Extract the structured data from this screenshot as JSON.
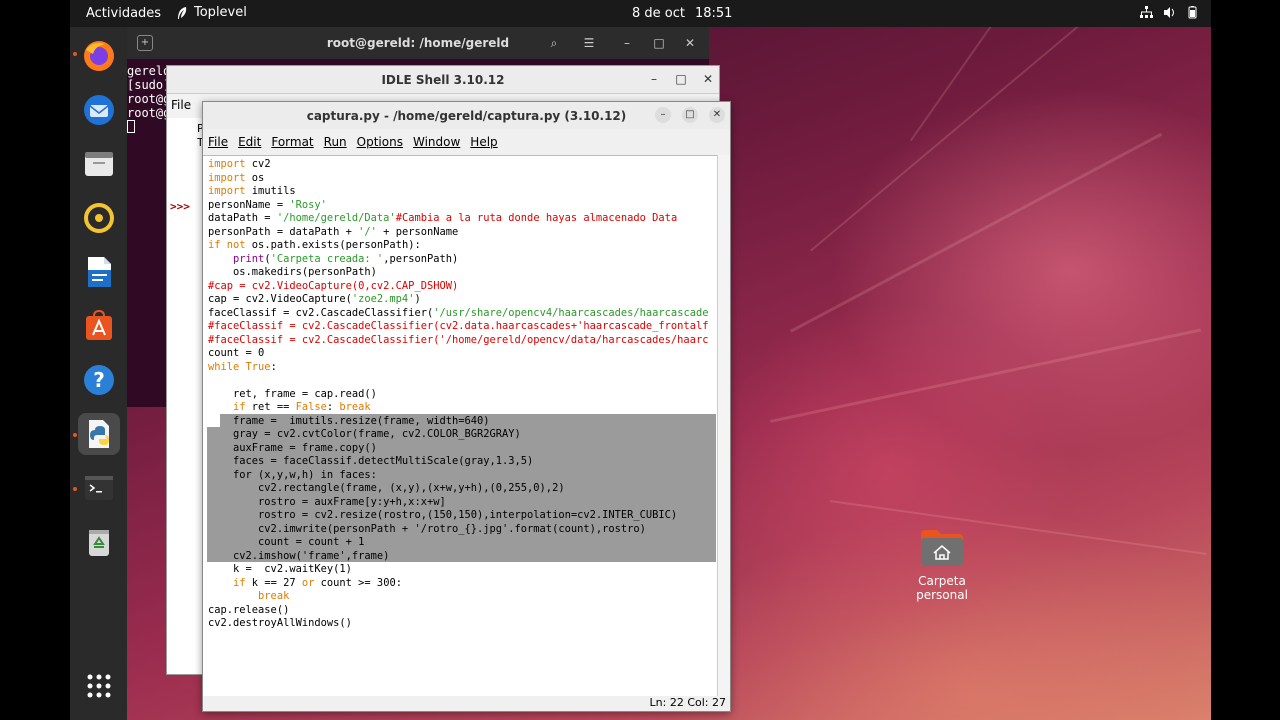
{
  "topbar": {
    "activities": "Actividades",
    "app_name": "Toplevel",
    "date": "8 de oct",
    "time": "18:51"
  },
  "dock": {
    "items": [
      "firefox-icon",
      "thunderbird-icon",
      "files-icon",
      "rhythmbox-icon",
      "writer-icon",
      "software-icon",
      "help-icon",
      "idle-python-icon",
      "terminal-icon",
      "trash-icon",
      "app-grid-icon"
    ]
  },
  "terminal": {
    "title": "root@gereld: /home/gereld",
    "lines": [
      "gereld",
      "[sudo]",
      "root@g",
      "root@g"
    ]
  },
  "idle_shell": {
    "title": "IDLE Shell 3.10.12",
    "menu_file": "File",
    "prompt": ">>>",
    "p_char": "P",
    "t_char": "T"
  },
  "editor": {
    "title": "captura.py - /home/gereld/captura.py (3.10.12)",
    "menu": [
      "File",
      "Edit",
      "Format",
      "Run",
      "Options",
      "Window",
      "Help"
    ],
    "status": "Ln: 22  Col: 27"
  },
  "desktop": {
    "home_folder_label": "Carpeta personal"
  },
  "colors": {
    "keyword": "#e07b00",
    "string": "#2a9a2a",
    "comment": "#dd0000",
    "builtin": "#900090",
    "selection": "#9b9b9b"
  }
}
